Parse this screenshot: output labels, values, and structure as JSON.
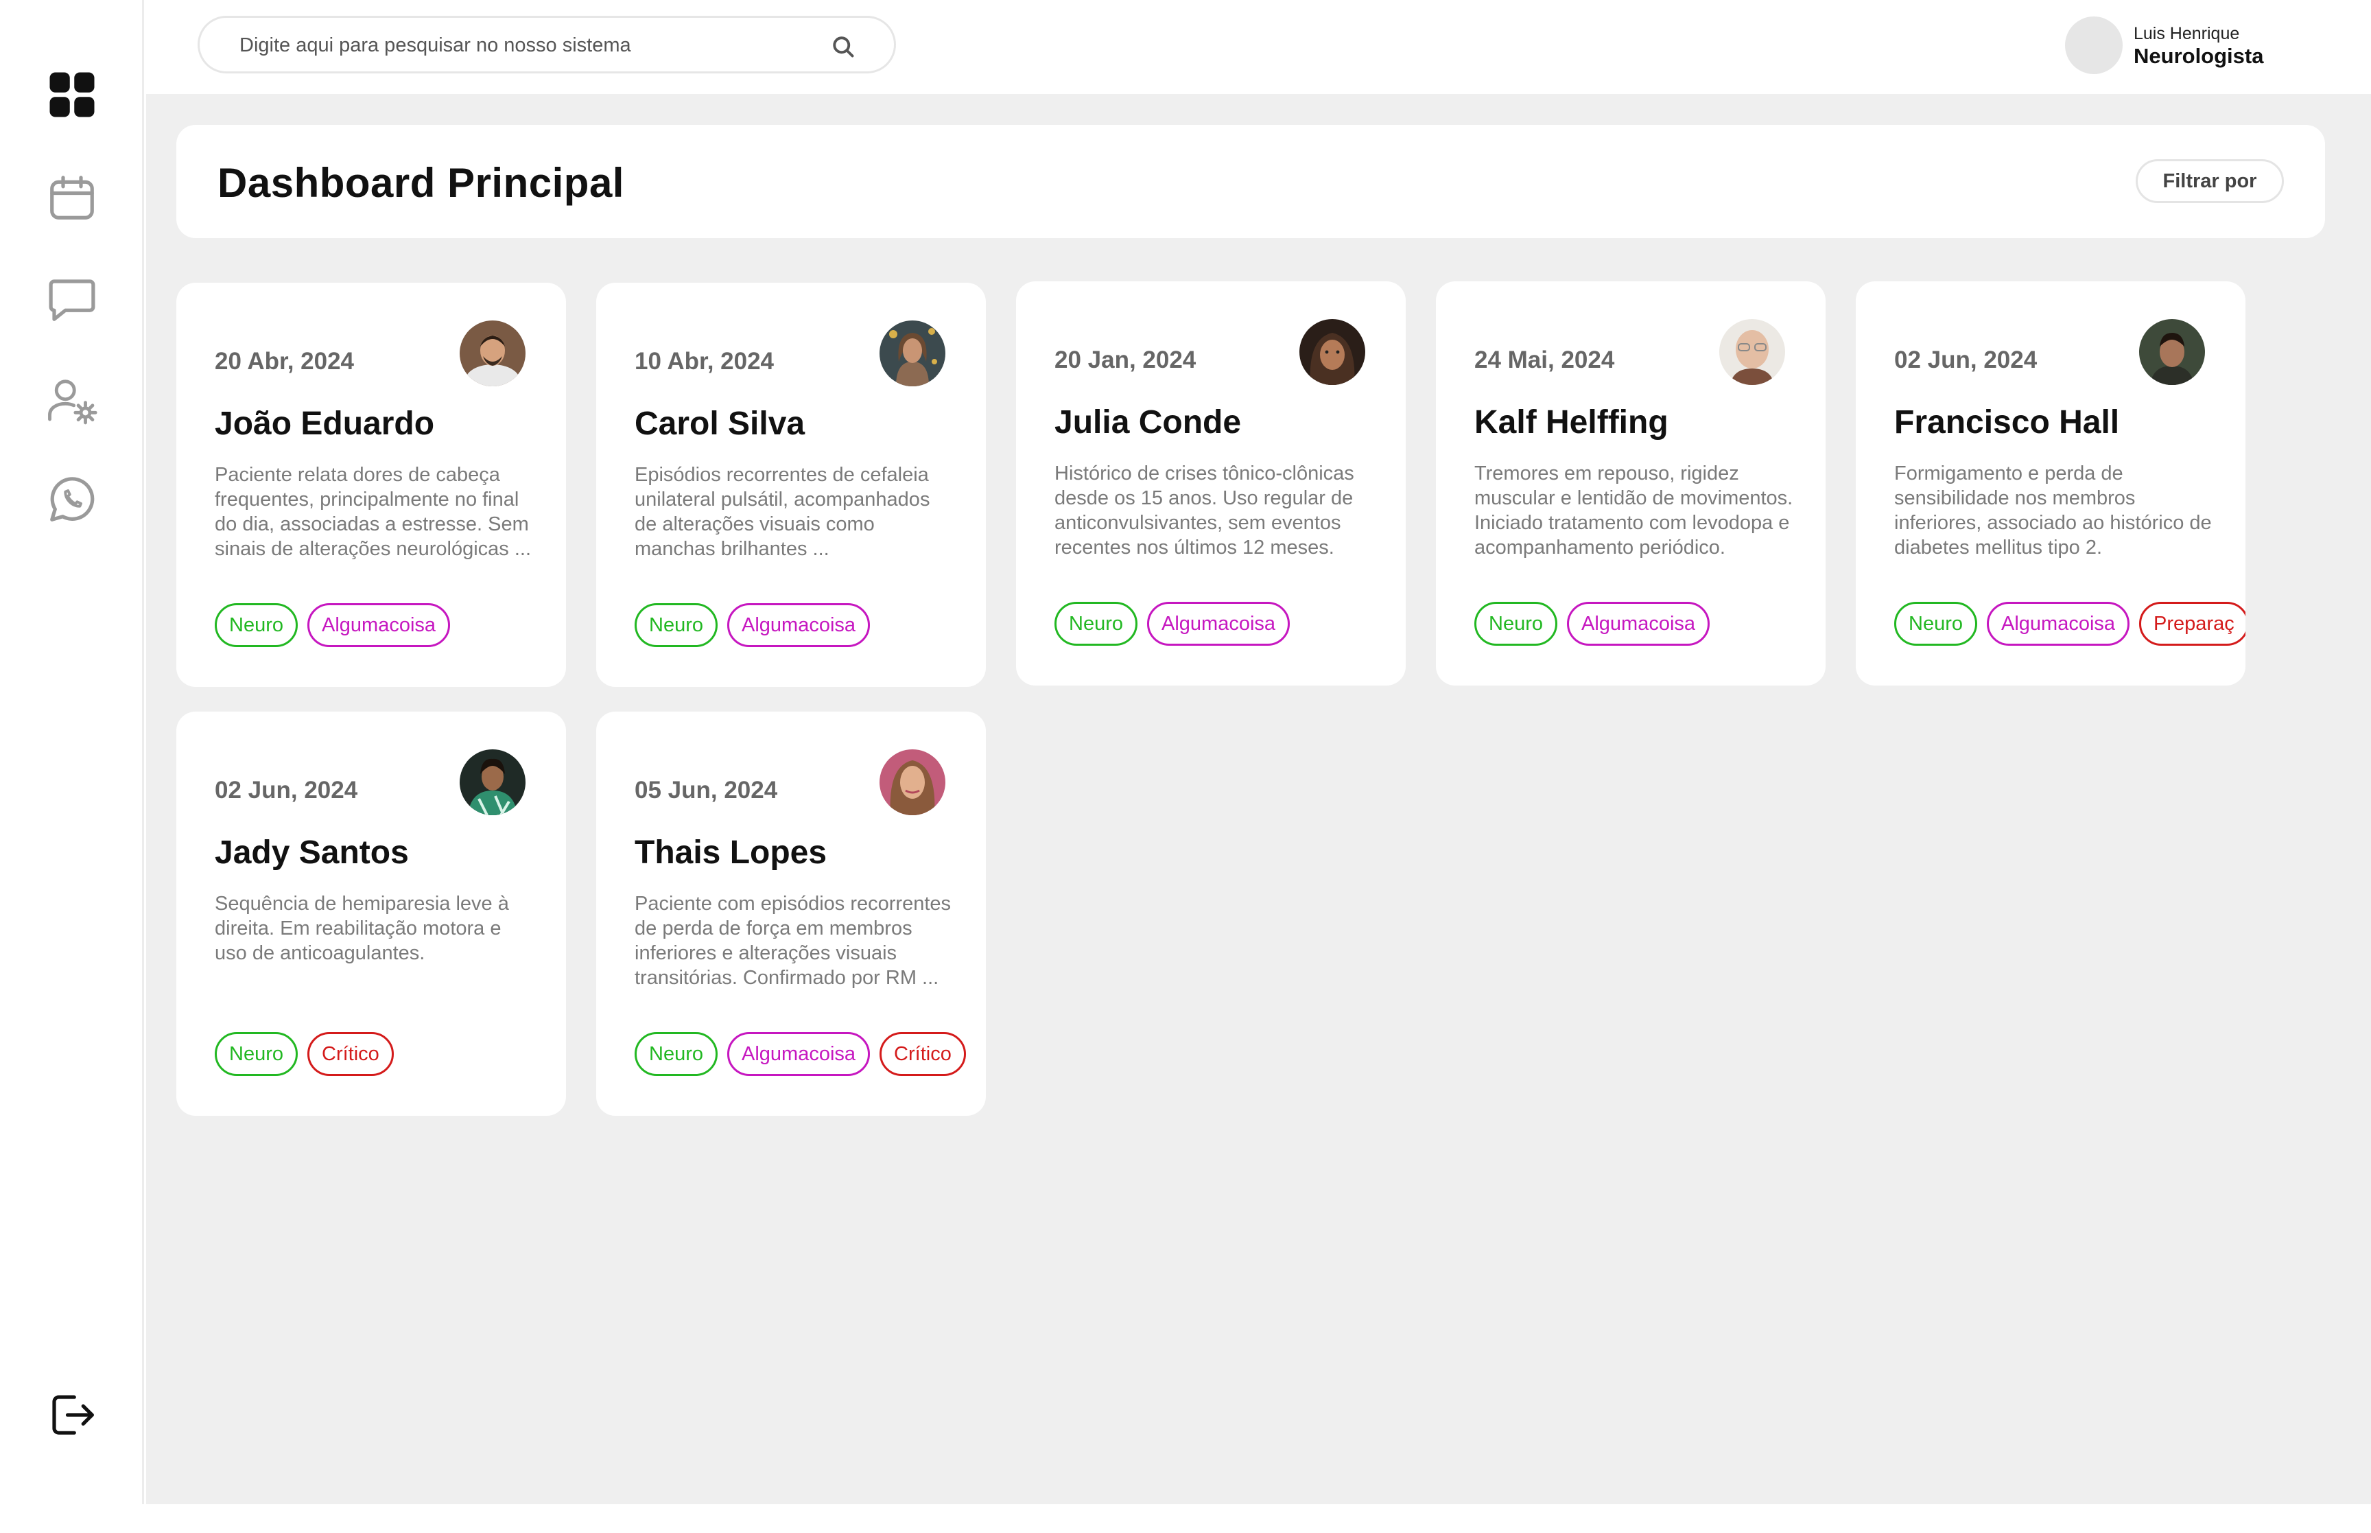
{
  "search": {
    "placeholder": "Digite aqui para pesquisar no nosso sistema"
  },
  "user": {
    "name": "Luis Henrique",
    "role": "Neurologista"
  },
  "page": {
    "title": "Dashboard Principal",
    "filter_label": "Filtrar por"
  },
  "sidebar": {
    "items": [
      "dashboard-icon",
      "calendar-icon",
      "chat-icon",
      "user-settings-icon",
      "whatsapp-icon"
    ],
    "bottom": "logout-icon"
  },
  "cards": [
    {
      "date": "20 Abr, 2024",
      "name": "João Eduardo",
      "description": "Paciente relata dores de cabeça frequentes, principalmente no final do dia, associadas a estresse. Sem sinais de alterações neurológicas ...",
      "tags": [
        {
          "label": "Neuro",
          "color": "#22b822"
        },
        {
          "label": "Algumacoisa",
          "color": "#c617c0"
        }
      ]
    },
    {
      "date": "10 Abr, 2024",
      "name": "Carol Silva",
      "description": "Episódios recorrentes de cefaleia unilateral pulsátil, acompanhados de alterações visuais como manchas brilhantes ...",
      "tags": [
        {
          "label": "Neuro",
          "color": "#22b822"
        },
        {
          "label": "Algumacoisa",
          "color": "#c617c0"
        }
      ]
    },
    {
      "date": "20 Jan, 2024",
      "name": "Julia Conde",
      "description": "Histórico de crises tônico-clônicas desde os 15 anos. Uso regular de anticonvulsivantes, sem eventos recentes nos últimos 12 meses.",
      "tags": [
        {
          "label": "Neuro",
          "color": "#22b822"
        },
        {
          "label": "Algumacoisa",
          "color": "#c617c0"
        }
      ]
    },
    {
      "date": "24 Mai, 2024",
      "name": "Kalf Helffing",
      "description": "Tremores em repouso, rigidez muscular e lentidão de movimentos. Iniciado tratamento com levodopa e acompanhamento periódico.",
      "tags": [
        {
          "label": "Neuro",
          "color": "#22b822"
        },
        {
          "label": "Algumacoisa",
          "color": "#c617c0"
        }
      ]
    },
    {
      "date": "02 Jun, 2024",
      "name": "Francisco Hall",
      "description": "Formigamento e perda de sensibilidade nos membros inferiores, associado ao histórico de diabetes mellitus tipo 2.",
      "tags": [
        {
          "label": "Neuro",
          "color": "#22b822"
        },
        {
          "label": "Algumacoisa",
          "color": "#c617c0"
        },
        {
          "label": "Preparaç",
          "color": "#d41b1b"
        }
      ]
    },
    {
      "date": "02 Jun, 2024",
      "name": "Jady Santos",
      "description": "Sequência de hemiparesia leve à direita. Em reabilitação motora e uso de anticoagulantes.",
      "tags": [
        {
          "label": "Neuro",
          "color": "#22b822"
        },
        {
          "label": "Crítico",
          "color": "#d41b1b"
        }
      ]
    },
    {
      "date": "05 Jun, 2024",
      "name": "Thais Lopes",
      "description": "Paciente com episódios recorrentes de perda de força em membros inferiores e alterações visuais transitórias. Confirmado por RM ...",
      "tags": [
        {
          "label": "Neuro",
          "color": "#22b822"
        },
        {
          "label": "Algumacoisa",
          "color": "#c617c0"
        },
        {
          "label": "Crítico",
          "color": "#d41b1b"
        }
      ]
    }
  ]
}
